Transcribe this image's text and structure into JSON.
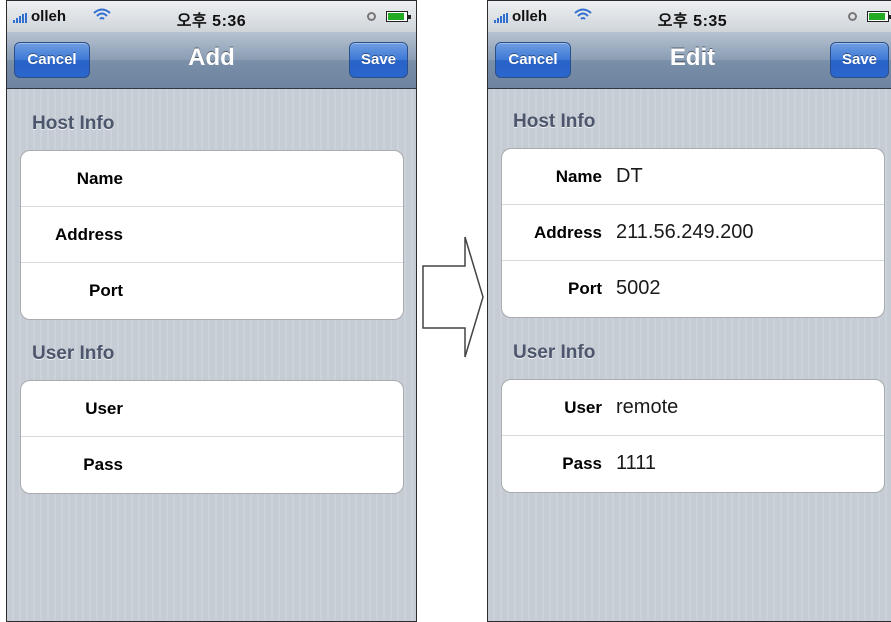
{
  "left": {
    "status": {
      "carrier": "olleh",
      "time": "오후 5:36"
    },
    "nav": {
      "cancel_label": "Cancel",
      "title": "Add",
      "save_label": "Save"
    },
    "host_section": {
      "header": "Host Info",
      "rows": [
        {
          "label": "Name",
          "value": ""
        },
        {
          "label": "Address",
          "value": ""
        },
        {
          "label": "Port",
          "value": ""
        }
      ]
    },
    "user_section": {
      "header": "User Info",
      "rows": [
        {
          "label": "User",
          "value": ""
        },
        {
          "label": "Pass",
          "value": ""
        }
      ]
    }
  },
  "right": {
    "status": {
      "carrier": "olleh",
      "time": "오후 5:35"
    },
    "nav": {
      "cancel_label": "Cancel",
      "title": "Edit",
      "save_label": "Save"
    },
    "host_section": {
      "header": "Host Info",
      "rows": [
        {
          "label": "Name",
          "value": "DT"
        },
        {
          "label": "Address",
          "value": "211.56.249.200"
        },
        {
          "label": "Port",
          "value": "5002"
        }
      ]
    },
    "user_section": {
      "header": "User Info",
      "rows": [
        {
          "label": "User",
          "value": "remote"
        },
        {
          "label": "Pass",
          "value": "1111"
        }
      ]
    }
  },
  "icons": {
    "signal": "signal-bars-icon",
    "wifi": "wifi-icon",
    "lock": "orientation-lock-icon",
    "battery": "battery-icon",
    "transition": "right-arrow-icon"
  },
  "colors": {
    "navbar": "#7a8fa8",
    "button": "#2f6fd0",
    "section_header": "#4c566c",
    "background_stripes": "#c5ccd4"
  }
}
